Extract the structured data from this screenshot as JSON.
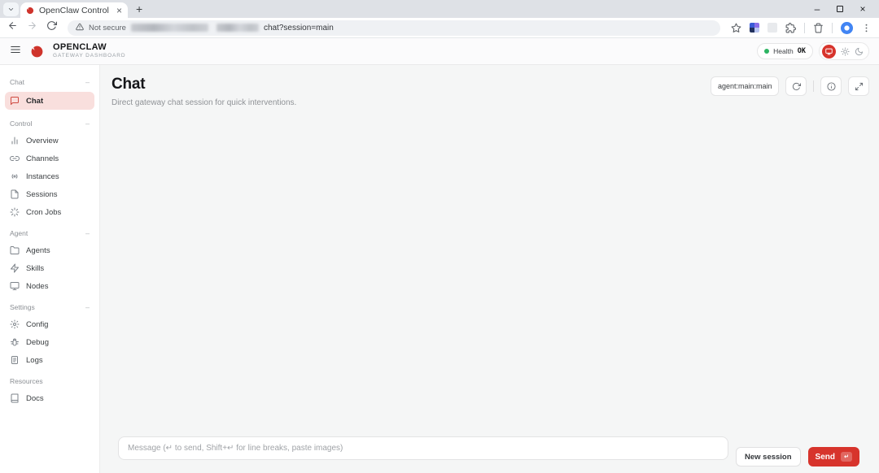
{
  "browser": {
    "tab_title": "OpenClaw Control",
    "tab_close": "×",
    "new_tab": "+",
    "security_label": "Not secure",
    "url_path": "chat?session=main",
    "window": {
      "minimize": "–",
      "close": "×"
    }
  },
  "header": {
    "brand_name": "OPENCLAW",
    "brand_subtitle": "GATEWAY DASHBOARD",
    "health_label": "Health",
    "health_status": "OK"
  },
  "sidebar": {
    "sections": [
      {
        "label": "Chat",
        "collapse": "–",
        "items": [
          {
            "label": "Chat",
            "icon": "chat-bubble-icon",
            "active": true
          }
        ]
      },
      {
        "label": "Control",
        "collapse": "–",
        "items": [
          {
            "label": "Overview",
            "icon": "bar-chart-icon"
          },
          {
            "label": "Channels",
            "icon": "link-icon"
          },
          {
            "label": "Instances",
            "icon": "broadcast-icon"
          },
          {
            "label": "Sessions",
            "icon": "file-text-icon"
          },
          {
            "label": "Cron Jobs",
            "icon": "loader-icon"
          }
        ]
      },
      {
        "label": "Agent",
        "collapse": "–",
        "items": [
          {
            "label": "Agents",
            "icon": "folder-icon"
          },
          {
            "label": "Skills",
            "icon": "zap-icon"
          },
          {
            "label": "Nodes",
            "icon": "monitor-icon"
          }
        ]
      },
      {
        "label": "Settings",
        "collapse": "–",
        "items": [
          {
            "label": "Config",
            "icon": "gear-icon"
          },
          {
            "label": "Debug",
            "icon": "bug-icon"
          },
          {
            "label": "Logs",
            "icon": "logs-icon"
          }
        ]
      },
      {
        "label": "Resources",
        "collapse": "",
        "items": [
          {
            "label": "Docs",
            "icon": "book-icon"
          }
        ]
      }
    ]
  },
  "main": {
    "title": "Chat",
    "subtitle": "Direct gateway chat session for quick interventions.",
    "session_value": "agent:main:main",
    "composer_placeholder": "Message (↵ to send, Shift+↵ for line breaks, paste images)",
    "new_session_label": "New session",
    "send_label": "Send",
    "send_shortcut": "↵"
  },
  "colors": {
    "accent_red": "#d7342c",
    "active_item_bg": "#f9dfdd",
    "health_green": "#2db462",
    "main_bg": "#f5f6f6"
  }
}
